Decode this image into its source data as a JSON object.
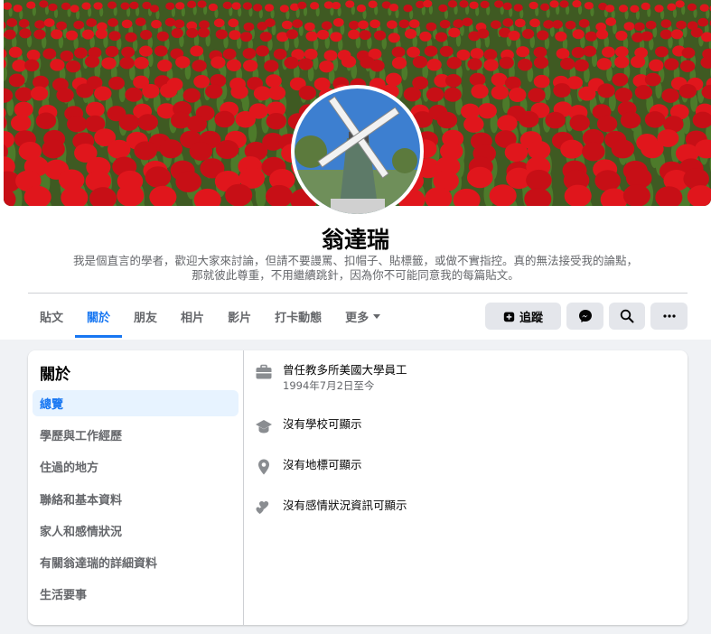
{
  "profile": {
    "name": "翁達瑞",
    "bio_line1": "我是個直言的學者，歡迎大家來討論，但請不要謾罵、扣帽子、貼標籤，或做不實指控。真的無法接受我的論點，",
    "bio_line2": "那就彼此尊重，不用繼續跳針，因為你不可能同意我的每篇貼文。"
  },
  "tabs": [
    {
      "label": "貼文"
    },
    {
      "label": "關於"
    },
    {
      "label": "朋友"
    },
    {
      "label": "相片"
    },
    {
      "label": "影片"
    },
    {
      "label": "打卡動態"
    },
    {
      "label": "更多"
    }
  ],
  "actions": {
    "follow_label": "追蹤"
  },
  "about": {
    "title": "關於",
    "sections": [
      {
        "label": "總覽"
      },
      {
        "label": "學歷與工作經歷"
      },
      {
        "label": "住過的地方"
      },
      {
        "label": "聯絡和基本資料"
      },
      {
        "label": "家人和感情狀況"
      },
      {
        "label": "有關翁達瑞的詳細資料"
      },
      {
        "label": "生活要事"
      }
    ],
    "work_title": "曾任教多所美國大學員工",
    "work_since": "1994年7月2日至今",
    "school": "沒有學校可顯示",
    "place": "沒有地標可顯示",
    "relationship": "沒有感情狀況資訊可顯示"
  },
  "colors": {
    "accent": "#1877f2",
    "tulip": "#e0161c",
    "sky": "#3d7fd0"
  },
  "icons": [
    "briefcase-icon",
    "graduation-cap-icon",
    "location-pin-icon",
    "hearts-icon",
    "follow-plus-icon",
    "messenger-icon",
    "search-icon",
    "more-dots-icon"
  ]
}
